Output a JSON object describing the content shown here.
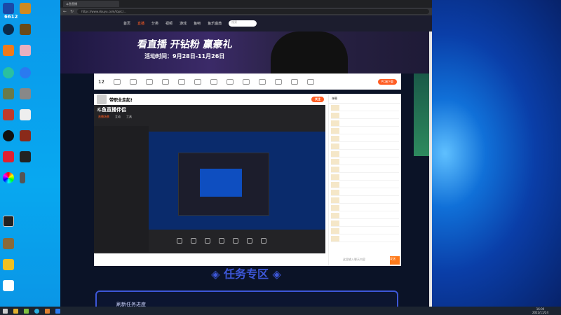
{
  "desktop": {
    "top_label": "6612"
  },
  "browser": {
    "tab_title": "斗鱼直播",
    "url": "https://www.douyu.com/topic/...",
    "nav": [
      "首页",
      "直播",
      "分类",
      "视频",
      "游戏",
      "鱼吧",
      "鱼乐盛典"
    ],
    "search_placeholder": "搜索"
  },
  "banner": {
    "headline": "看直播 开钻粉 赢豪礼",
    "period": "活动时间：9月28日-11月26日"
  },
  "toolbar": {
    "count": "12",
    "cta": "PC端下载"
  },
  "stream": {
    "title": "带职业走起!",
    "follow": "关注"
  },
  "app": {
    "name": "斗鱼直播伴侣",
    "tabs": [
      "直播场景",
      "互动",
      "工具"
    ]
  },
  "chat": {
    "tab": "弹幕",
    "placeholder": "这里输入聊天内容",
    "send": "发送"
  },
  "tasks": {
    "heading": "◈ 任务专区 ◈",
    "refresh": "刷新任务进度"
  },
  "taskbar": {
    "time": "16:00",
    "date": "2022/11/24"
  }
}
